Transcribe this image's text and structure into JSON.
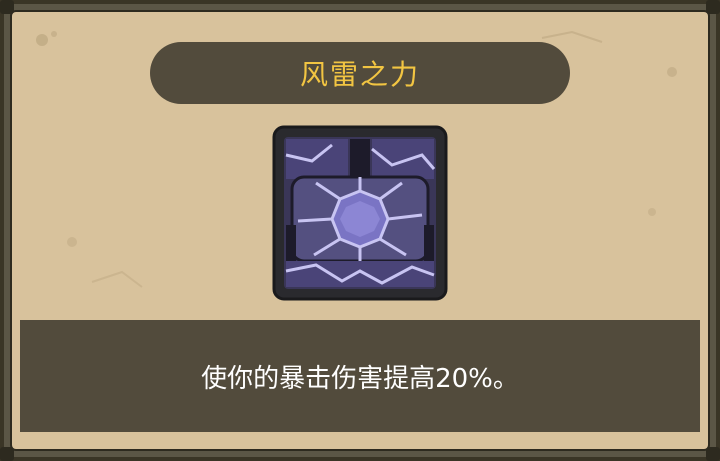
{
  "skill": {
    "title": "风雷之力",
    "description": "使你的暴击伤害提高20%。",
    "icon": "lightning-gear-icon"
  },
  "colors": {
    "title": "#f2c542",
    "banner": "#524b3c",
    "parchment": "#d8c29c",
    "icon_purple": "#6e64a8",
    "icon_glow": "#c8c4f2"
  }
}
